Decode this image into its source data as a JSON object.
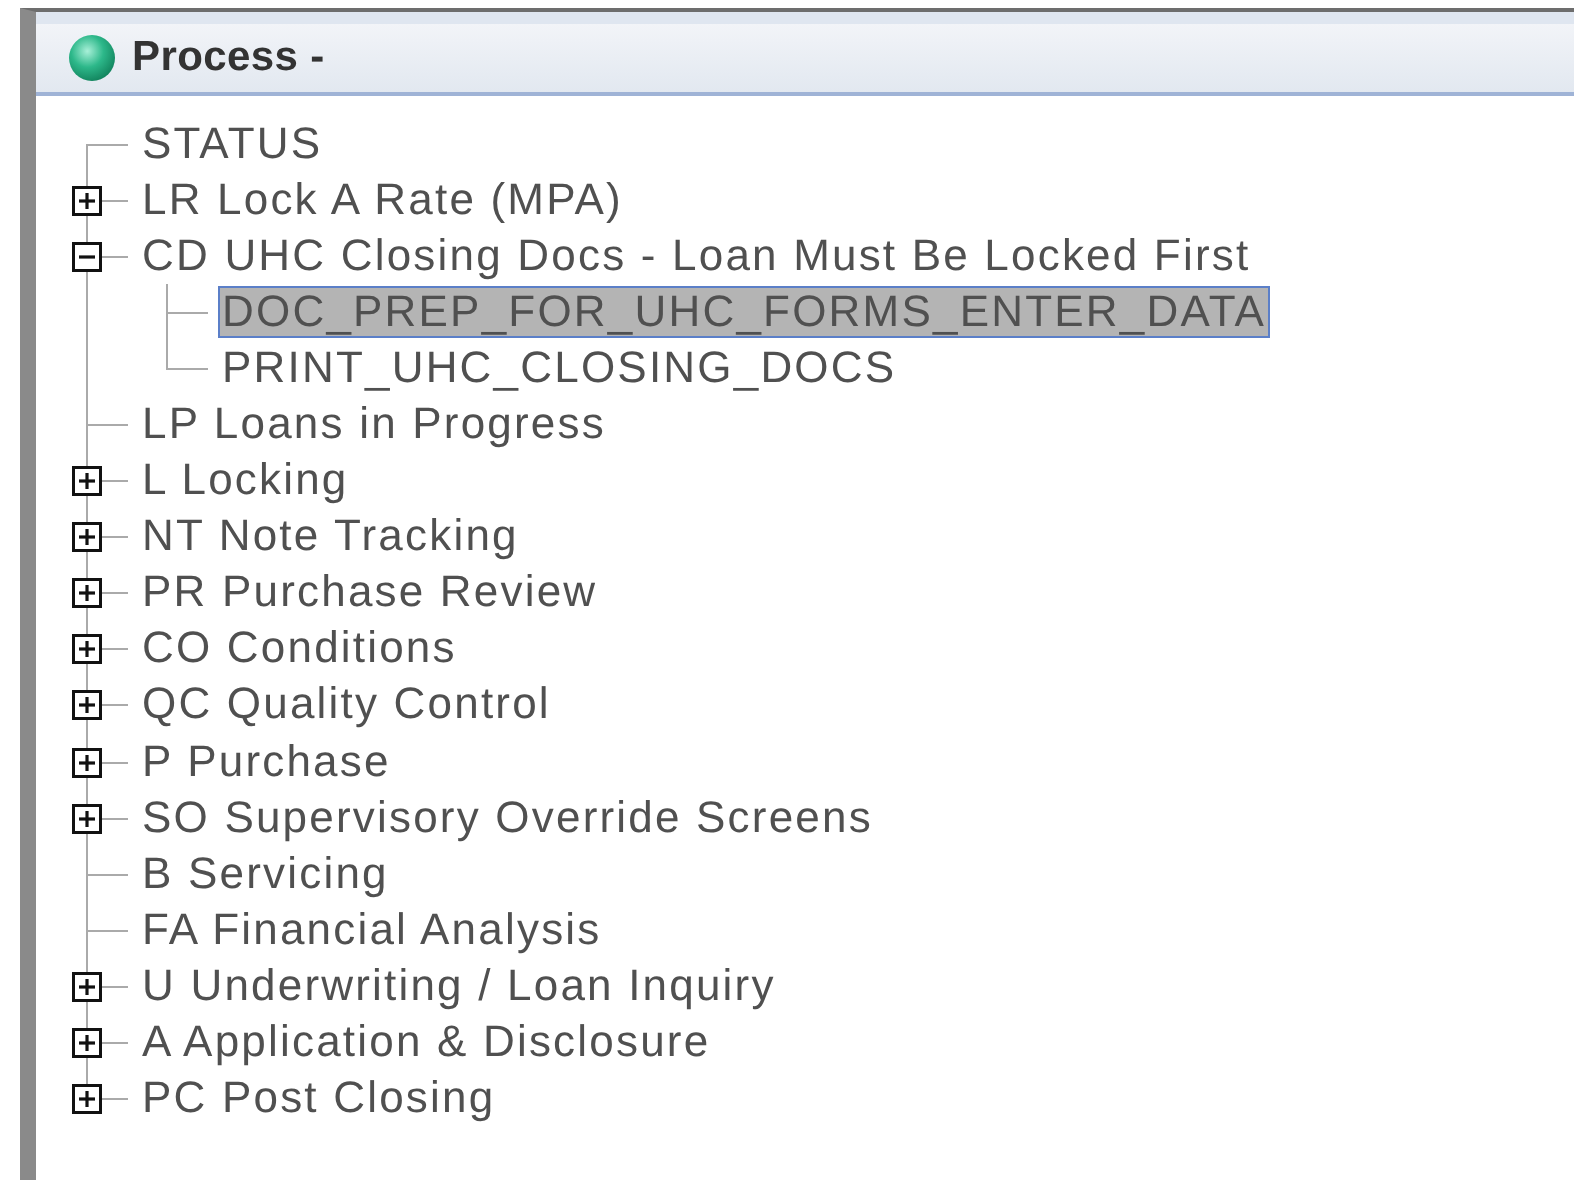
{
  "window": {
    "title": "Process -"
  },
  "tree": [
    {
      "label": "STATUS",
      "kind": "leaf",
      "selected": false
    },
    {
      "label": "LR Lock A Rate (MPA)",
      "kind": "branch",
      "expanded": false,
      "selected": false
    },
    {
      "label": "CD UHC Closing Docs - Loan Must Be Locked First",
      "kind": "branch",
      "expanded": true,
      "selected": false,
      "children": [
        {
          "label": "DOC_PREP_FOR_UHC_FORMS_ENTER_DATA",
          "selected": true
        },
        {
          "label": "PRINT_UHC_CLOSING_DOCS",
          "selected": false
        }
      ]
    },
    {
      "label": "LP Loans in Progress",
      "kind": "leaf",
      "selected": false
    },
    {
      "label": "L Locking",
      "kind": "branch",
      "expanded": false,
      "selected": false
    },
    {
      "label": "NT Note Tracking",
      "kind": "branch",
      "expanded": false,
      "selected": false
    },
    {
      "label": "PR Purchase Review",
      "kind": "branch",
      "expanded": false,
      "selected": false
    },
    {
      "label": "CO Conditions",
      "kind": "branch",
      "expanded": false,
      "selected": false
    },
    {
      "label": "QC Quality Control",
      "kind": "branch",
      "expanded": false,
      "selected": false
    },
    {
      "label": "P Purchase",
      "kind": "branch",
      "expanded": false,
      "selected": false
    },
    {
      "label": "SO Supervisory Override Screens",
      "kind": "branch",
      "expanded": false,
      "selected": false
    },
    {
      "label": "B Servicing",
      "kind": "leaf",
      "selected": false
    },
    {
      "label": "FA Financial Analysis",
      "kind": "leaf",
      "selected": false
    },
    {
      "label": "U Underwriting / Loan Inquiry",
      "kind": "branch",
      "expanded": false,
      "selected": false
    },
    {
      "label": "A Application & Disclosure",
      "kind": "branch",
      "expanded": false,
      "selected": false
    },
    {
      "label": "PC Post Closing",
      "kind": "branch",
      "expanded": false,
      "selected": false
    }
  ]
}
